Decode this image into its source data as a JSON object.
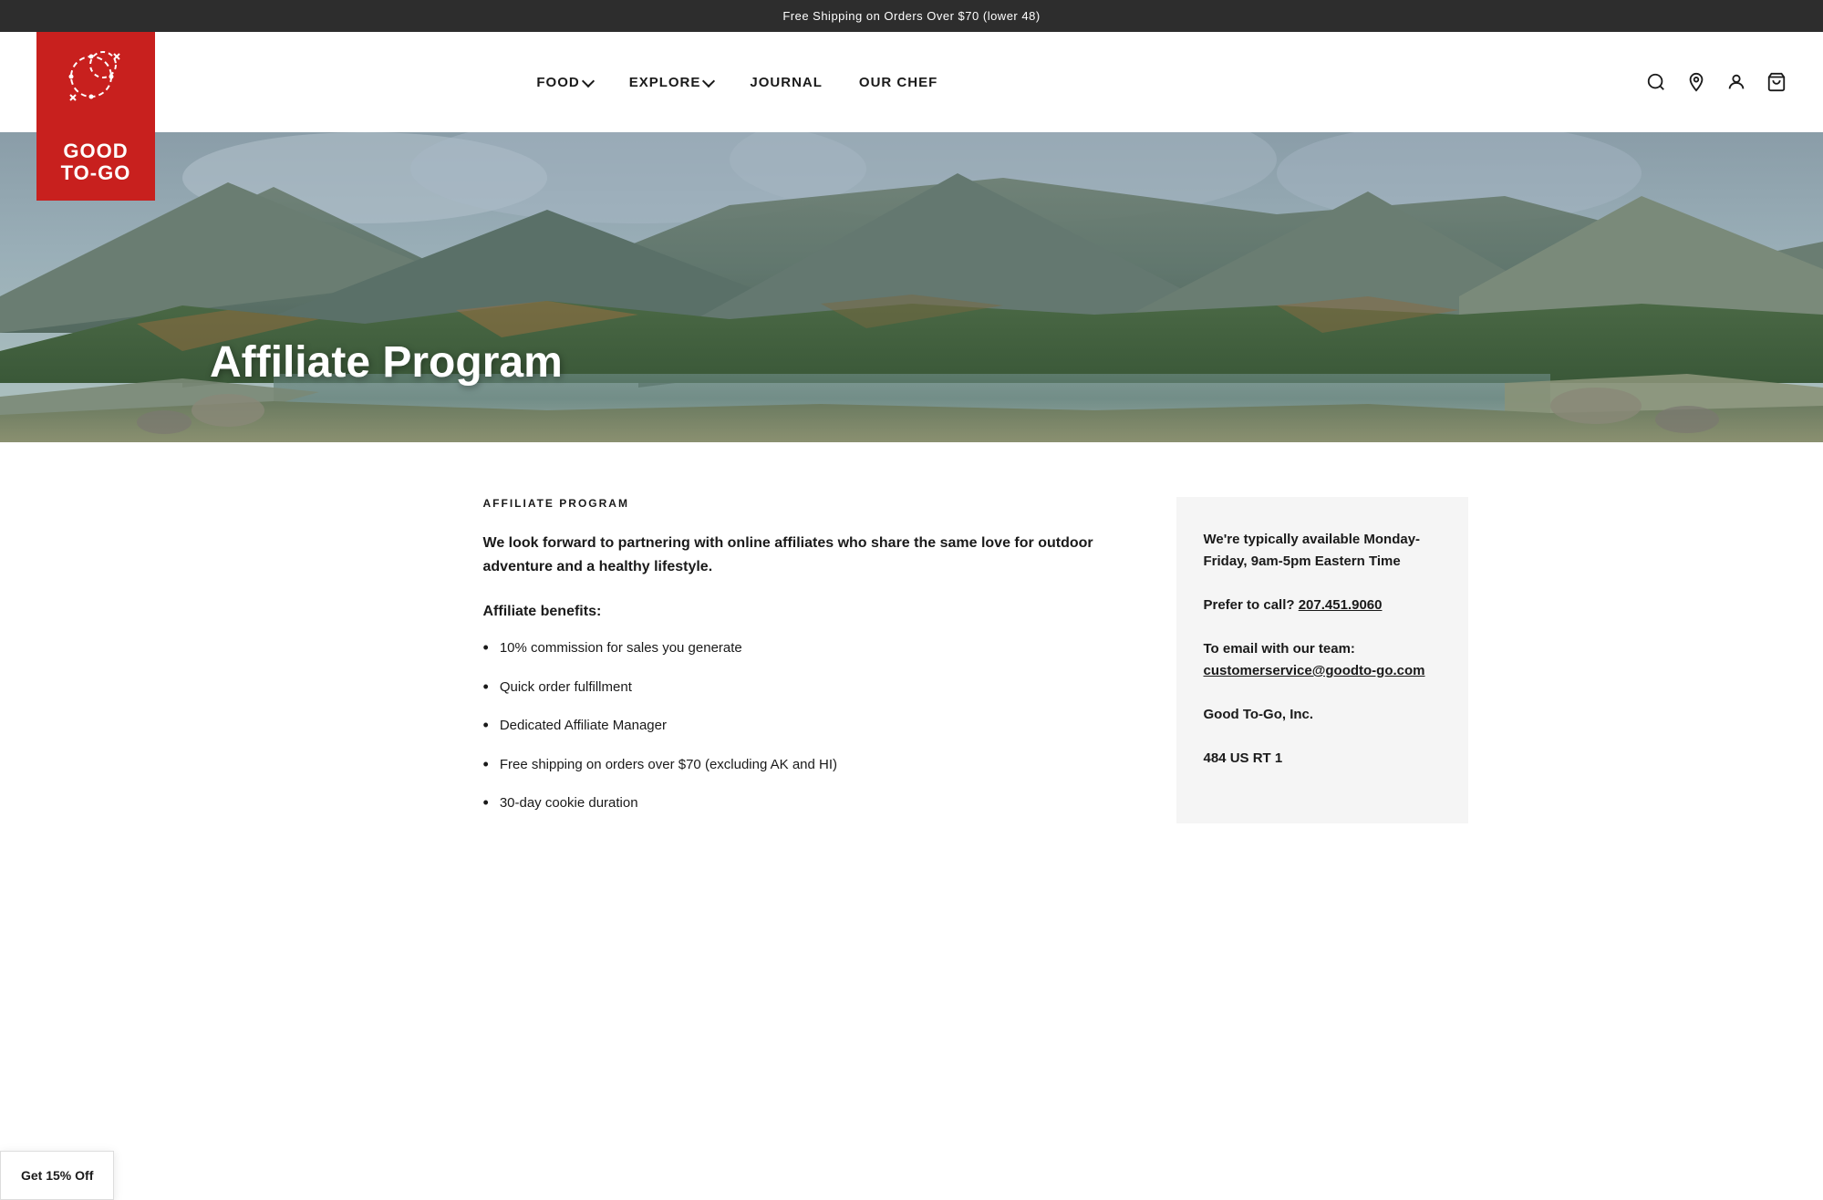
{
  "banner": {
    "text": "Free Shipping on Orders Over $70 (lower 48)"
  },
  "header": {
    "logo_text": "GOOD\nTO-GO",
    "nav_items": [
      {
        "label": "FOOD",
        "has_dropdown": true
      },
      {
        "label": "EXPLORE",
        "has_dropdown": true
      },
      {
        "label": "JOURNAL",
        "has_dropdown": false
      },
      {
        "label": "OUR CHEF",
        "has_dropdown": false
      }
    ]
  },
  "hero": {
    "title": "Affiliate Program"
  },
  "content": {
    "section_label": "AFFILIATE PROGRAM",
    "intro": "We look forward to partnering with online affiliates who share the same love for outdoor adventure and a healthy lifestyle.",
    "benefits_title": "Affiliate benefits:",
    "benefits": [
      "10% commission for sales you generate",
      "Quick order fulfillment",
      "Dedicated Affiliate Manager",
      "Free shipping on orders over $70 (excluding AK and HI)",
      "30-day cookie duration"
    ]
  },
  "sidebar": {
    "availability": "We're typically available Monday-Friday, 9am-5pm Eastern Time",
    "phone_label": "Prefer to call?",
    "phone": "207.451.9060",
    "email_label": "To email with our team:",
    "email": "customerservice@goodto-go.com",
    "company": "Good To-Go, Inc.",
    "address": "484 US RT 1"
  },
  "popup": {
    "label": "Get 15% Off"
  },
  "icons": {
    "search": "🔍",
    "location": "📍",
    "account": "👤",
    "cart": "🛍"
  }
}
